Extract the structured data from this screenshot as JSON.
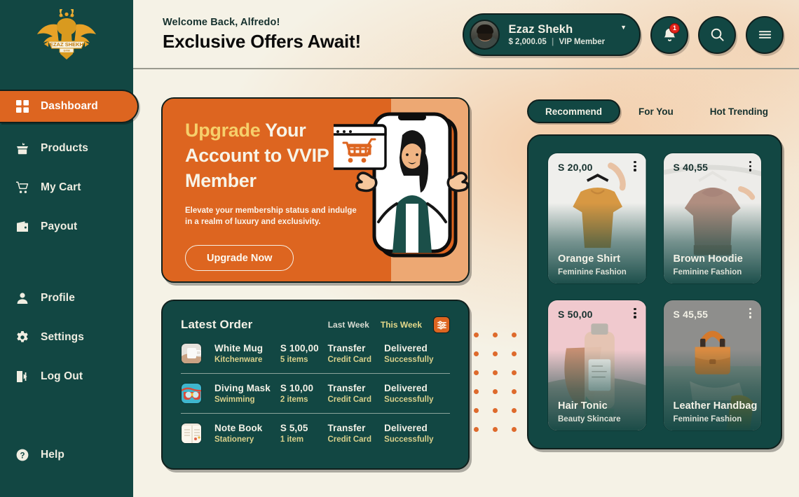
{
  "brand": {
    "logo_name": "ezaz-shekh-logo",
    "logo_text": "EZAZ SHEKH",
    "logo_sub": "GYM"
  },
  "sidebar": {
    "items": [
      {
        "label": "Dashboard",
        "icon": "grid-icon",
        "active": true
      },
      {
        "label": "Products",
        "icon": "box-icon",
        "active": false
      },
      {
        "label": "My Cart",
        "icon": "cart-icon",
        "active": false
      },
      {
        "label": "Payout",
        "icon": "wallet-icon",
        "active": false
      },
      {
        "label": "Profile",
        "icon": "user-icon",
        "active": false
      },
      {
        "label": "Settings",
        "icon": "gear-icon",
        "active": false
      },
      {
        "label": "Log Out",
        "icon": "logout-icon",
        "active": false
      },
      {
        "label": "Help",
        "icon": "question-circle-icon",
        "active": false
      }
    ]
  },
  "header": {
    "welcome": "Welcome Back, Alfredo!",
    "headline": "Exclusive Offers Await!",
    "user": {
      "name": "Ezaz Shekh",
      "balance": "$ 2,000.05",
      "separator": "|",
      "membership": "VIP Member",
      "caret": "▼"
    },
    "notification_count": "1",
    "icons": {
      "bell": "bell-icon",
      "search": "search-icon",
      "menu": "hamburger-menu-icon"
    }
  },
  "promo": {
    "title_highlight": "Upgrade",
    "title_rest": " Your Account to VVIP Member",
    "description": "Elevate your membership status and indulge in a realm of luxury and exclusivity.",
    "button": "Upgrade Now",
    "colors": {
      "bg": "#DD6520",
      "highlight": "#F6CF6B"
    }
  },
  "orders": {
    "title": "Latest Order",
    "filters": [
      {
        "label": "Last Week",
        "active": false
      },
      {
        "label": "This Week",
        "active": true
      }
    ],
    "filter_icon": "filter-sliders-icon",
    "rows": [
      {
        "name": "White Mug",
        "category": "Kitchenware",
        "price": "S 100,00",
        "items": "5 items",
        "method": "Transfer",
        "method_sub": "Credit Card",
        "status": "Delivered",
        "status_sub": "Successfully",
        "thumb": "white-mug-thumbnail"
      },
      {
        "name": "Diving Mask",
        "category": "Swimming",
        "price": "S 10,00",
        "items": "2 items",
        "method": "Transfer",
        "method_sub": "Credit Card",
        "status": "Delivered",
        "status_sub": "Successfully",
        "thumb": "diving-mask-thumbnail"
      },
      {
        "name": "Note Book",
        "category": "Stationery",
        "price": "S 5,05",
        "items": "1 item",
        "method": "Transfer",
        "method_sub": "Credit Card",
        "status": "Delivered",
        "status_sub": "Successfully",
        "thumb": "note-book-thumbnail"
      }
    ]
  },
  "recommend": {
    "tabs": [
      {
        "label": "Recommend",
        "active": true
      },
      {
        "label": "For You",
        "active": false
      },
      {
        "label": "Hot Trending",
        "active": false
      }
    ],
    "products": [
      {
        "price": "S 20,00",
        "name": "Orange Shirt",
        "category": "Feminine Fashion",
        "image": "orange-shirt-photo",
        "price_light": false
      },
      {
        "price": "S 40,55",
        "name": "Brown Hoodie",
        "category": "Feminine Fashion",
        "image": "brown-hoodie-photo",
        "price_light": false
      },
      {
        "price": "S 50,00",
        "name": "Hair Tonic",
        "category": "Beauty Skincare",
        "image": "hair-tonic-photo",
        "price_light": false
      },
      {
        "price": "S 45,55",
        "name": "Leather Handbag",
        "category": "Feminine Fashion",
        "image": "leather-handbag-photo",
        "price_light": true
      }
    ]
  },
  "theme": {
    "green": "#124743",
    "orange": "#DD6520",
    "cream": "#F5F2E6",
    "yellow": "#E4D98A"
  }
}
